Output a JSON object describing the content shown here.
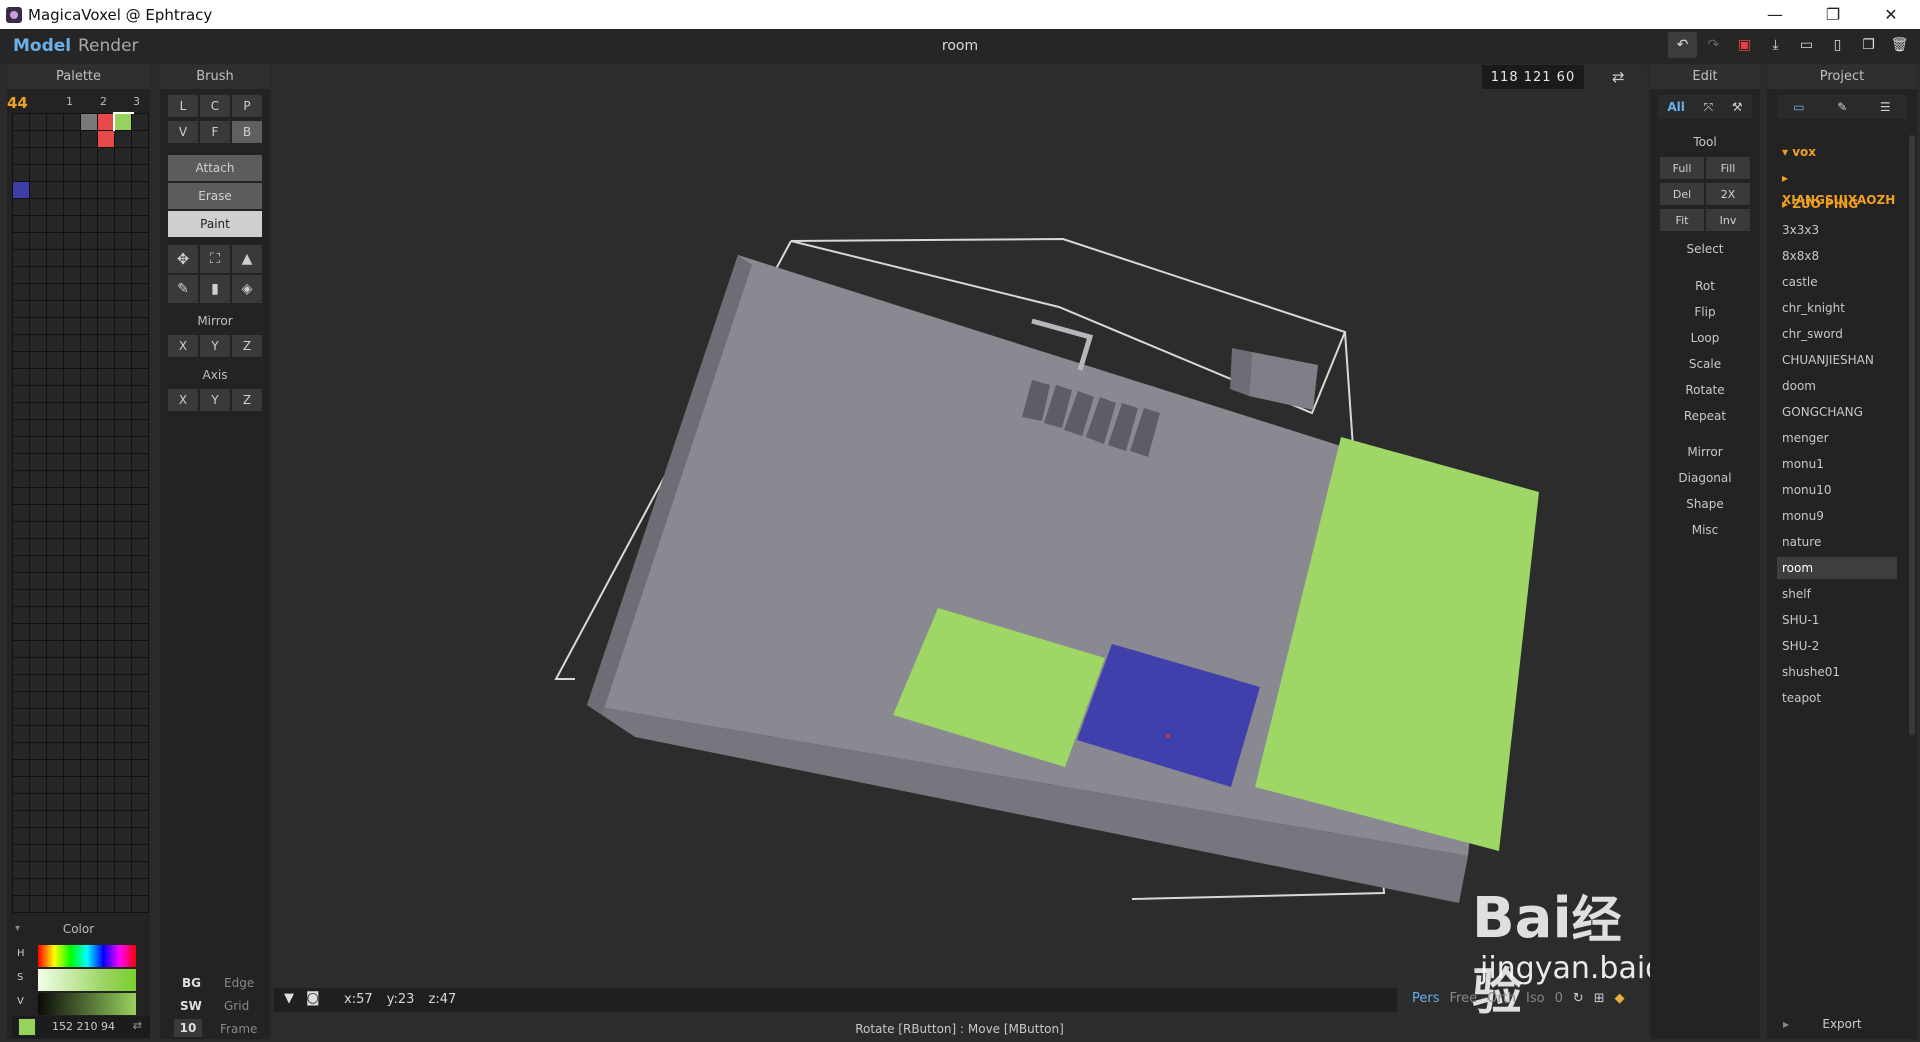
{
  "window": {
    "title": "MagicaVoxel @ Ephtracy",
    "minimize": "—",
    "maximize": "❐",
    "close": "✕"
  },
  "menu": {
    "model": "Model",
    "render": "Render",
    "filename": "room"
  },
  "toolbar_icons": [
    "undo-icon",
    "redo-icon",
    "save-icon",
    "export-icon",
    "open-icon",
    "new-icon",
    "copy-icon",
    "delete-icon"
  ],
  "palette": {
    "title": "Palette",
    "count": "44",
    "tabs": [
      "1",
      "2",
      "3"
    ],
    "colors": {
      "gray": "#7a7a7a",
      "red": "#e84a4a",
      "green": "#98d25e",
      "blue": "#3e3ea8"
    }
  },
  "color": {
    "title": "Color",
    "h_label": "H",
    "s_label": "S",
    "v_label": "V",
    "rgb": "152  210  94",
    "swatch": "#98d25e",
    "swap": "⇄"
  },
  "brush": {
    "title": "Brush",
    "row1": [
      "L",
      "C",
      "P"
    ],
    "row2": [
      "V",
      "F",
      "B"
    ],
    "attach": "Attach",
    "erase": "Erase",
    "paint": "Paint",
    "mirror": "Mirror",
    "axis": "Axis",
    "xyz": [
      "X",
      "Y",
      "Z"
    ],
    "bg": "BG",
    "edge": "Edge",
    "sw": "SW",
    "grid": "Grid",
    "frame_num": "10",
    "frame": "Frame"
  },
  "viewport": {
    "dims": "118  121  60",
    "cursor": "x:57   y:23   z:47",
    "views": [
      "Pers",
      "Free",
      "Orth",
      "Iso",
      "0"
    ],
    "status": "Rotate [RButton] : Move [MButton]",
    "colors": {
      "bg": "#2c2c2c",
      "voxel": "#8a8890",
      "green": "#9ed766",
      "blue": "#4040ac"
    }
  },
  "edit": {
    "title": "Edit",
    "all": "All",
    "tool": "Tool",
    "tool_buttons": [
      "Full",
      "Fill",
      "Del",
      "2X",
      "Fit",
      "Inv"
    ],
    "select": "Select",
    "ops": [
      "Rot",
      "Flip",
      "Loop",
      "Scale",
      "Rotate",
      "Repeat"
    ],
    "ops2": [
      "Mirror",
      "Diagonal",
      "Shape",
      "Misc"
    ]
  },
  "project": {
    "title": "Project",
    "root": "▾ vox",
    "folders": [
      "▸ XIANGSUIXAOZH",
      "▸ ZUO PING"
    ],
    "files": [
      "3x3x3",
      "8x8x8",
      "castle",
      "chr_knight",
      "chr_sword",
      "CHUANJIESHAN",
      "doom",
      "GONGCHANG",
      "menger",
      "monu1",
      "monu10",
      "monu9",
      "nature",
      "room",
      "shelf",
      "SHU-1",
      "SHU-2",
      "shushe01",
      "teapot"
    ],
    "selected": "room",
    "export": "Export"
  },
  "watermark": {
    "line1": "Bai",
    "line2": "经验",
    "url": "jingyan.baidu.com"
  }
}
